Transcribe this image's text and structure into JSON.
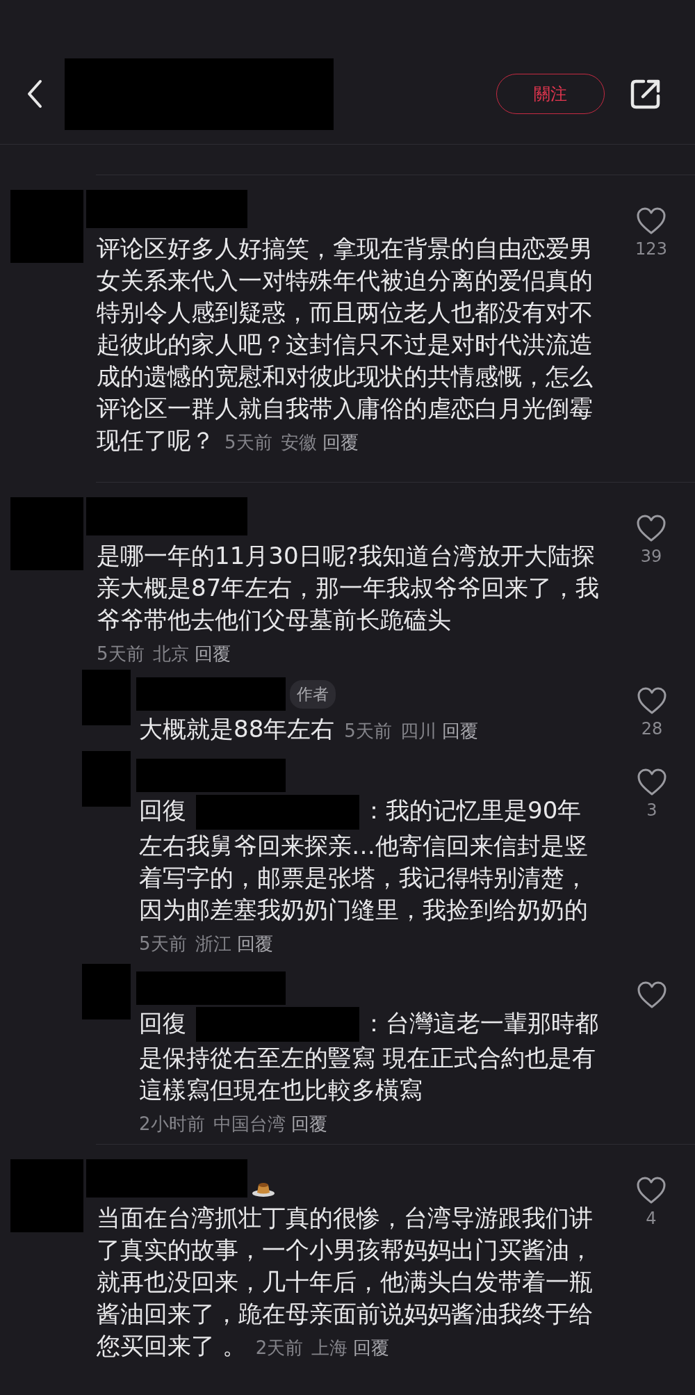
{
  "header": {
    "follow_button": "關注"
  },
  "comments": [
    {
      "text": "评论区好多人好搞笑，拿现在背景的自由恋爱男女关系来代入一对特殊年代被迫分离的爱侣真的特别令人感到疑惑，而且两位老人也都没有对不起彼此的家人吧？这封信只不过是对时代洪流造成的遗憾的宽慰和对彼此现状的共情感慨，怎么评论区一群人就自我带入庸俗的虐恋白月光倒霉现任了呢？",
      "time": "5天前",
      "location": "安徽",
      "reply": "回覆",
      "likes": "123",
      "meta_below": false
    },
    {
      "text": "是哪一年的11月30日呢?我知道台湾放开大陆探亲大概是87年左右，那一年我叔爷爷回来了，我爷爷带他去他们父母墓前长跪磕头",
      "time": "5天前",
      "location": "北京",
      "reply": "回覆",
      "likes": "39",
      "meta_below": true,
      "replies": [
        {
          "badge": "作者",
          "text": "大概就是88年左右",
          "time": "5天前",
          "location": "四川",
          "reply": "回覆",
          "likes": "28",
          "meta_below": false
        },
        {
          "reply_prefix": "回復",
          "text": "：我的记忆里是90年左右我舅爷回来探亲…他寄信回来信封是竖着写字的，邮票是张塔，我记得特别清楚，因为邮差塞我奶奶门缝里，我捡到给奶奶的",
          "time": "5天前",
          "location": "浙江",
          "reply": "回覆",
          "likes": "3",
          "meta_below": true
        },
        {
          "reply_prefix": "回復",
          "text": "：台灣這老一輩那時都是保持從右至左的豎寫 現在正式合約也是有這樣寫但現在也比較多橫寫",
          "time": "2小时前",
          "location": "中国台湾",
          "reply": "回覆",
          "meta_below": true
        }
      ]
    },
    {
      "name_emoji": true,
      "text": "当面在台湾抓壮丁真的很惨，台湾导游跟我们讲了真实的故事，一个小男孩帮妈妈出门买酱油，就再也没回来，几十年后，他满头白发带着一瓶酱油回来了，跪在母亲面前说妈妈酱油我终于给您买回来了 。",
      "time": "2天前",
      "location": "上海",
      "reply": "回覆",
      "likes": "4",
      "meta_below": false
    }
  ]
}
